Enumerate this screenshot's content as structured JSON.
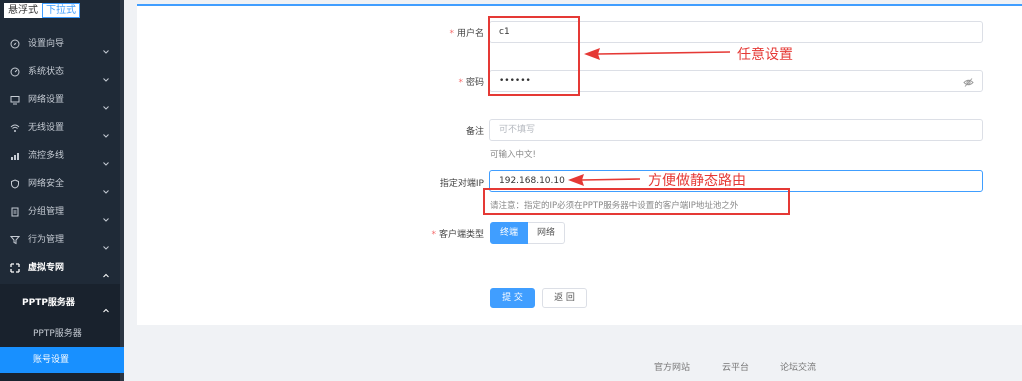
{
  "mode_switch": {
    "floating": "悬浮式",
    "dropdown": "下拉式"
  },
  "sidebar": {
    "items": [
      {
        "label": "设置向导",
        "icon": "compass-icon"
      },
      {
        "label": "系统状态",
        "icon": "gauge-icon"
      },
      {
        "label": "网络设置",
        "icon": "monitor-icon"
      },
      {
        "label": "无线设置",
        "icon": "wifi-icon"
      },
      {
        "label": "流控多线",
        "icon": "flow-icon"
      },
      {
        "label": "网络安全",
        "icon": "shield-icon"
      },
      {
        "label": "分组管理",
        "icon": "file-icon"
      },
      {
        "label": "行为管理",
        "icon": "filter-icon"
      },
      {
        "label": "虚拟专网",
        "icon": "vpn-icon"
      }
    ],
    "submenu": {
      "label": "PPTP服务器"
    },
    "sub_items": [
      {
        "label": "PPTP服务器"
      },
      {
        "label": "账号设置"
      }
    ]
  },
  "form": {
    "username": {
      "label": "用户名",
      "value": "c1"
    },
    "password": {
      "label": "密码",
      "value": "••••••"
    },
    "remark": {
      "label": "备注",
      "placeholder": "可不填写",
      "hint": "可输入中文!"
    },
    "peer_ip": {
      "label": "指定对端IP",
      "value": "192.168.10.10",
      "hint": "请注意：指定的IP必须在PPTP服务器中设置的客户端IP地址池之外"
    },
    "client_type": {
      "label": "客户端类型",
      "options": [
        "终端",
        "网络"
      ],
      "selected": "终端"
    },
    "submit_label": "提 交",
    "back_label": "返 回"
  },
  "annotations": {
    "arbitrary": "任意设置",
    "static_route": "方便做静态路由"
  },
  "footer": {
    "links": [
      "官方网站",
      "云平台",
      "论坛交流"
    ]
  },
  "colors": {
    "accent": "#409eff",
    "sidebar_bg": "#1f2a37",
    "active_item": "#1890ff",
    "annotation": "#e53935"
  }
}
